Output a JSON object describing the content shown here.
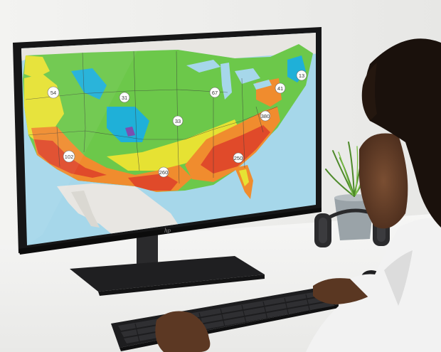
{
  "brand": {
    "logo_text": "hp"
  },
  "map": {
    "cluster_markers": [
      {
        "label": "54"
      },
      {
        "label": "31"
      },
      {
        "label": "67"
      },
      {
        "label": "41"
      },
      {
        "label": "13"
      },
      {
        "label": "33"
      },
      {
        "label": "380"
      },
      {
        "label": "102"
      },
      {
        "label": "260"
      },
      {
        "label": "250"
      }
    ],
    "colors": {
      "low": "#1fb0d8",
      "low_mid": "#6cc84a",
      "mid": "#e6e233",
      "high_mid": "#f08c2e",
      "high": "#e04a2a",
      "peak": "#7a4fb0",
      "water": "#a6d7ea",
      "land_outside": "#e8e6e2"
    }
  }
}
